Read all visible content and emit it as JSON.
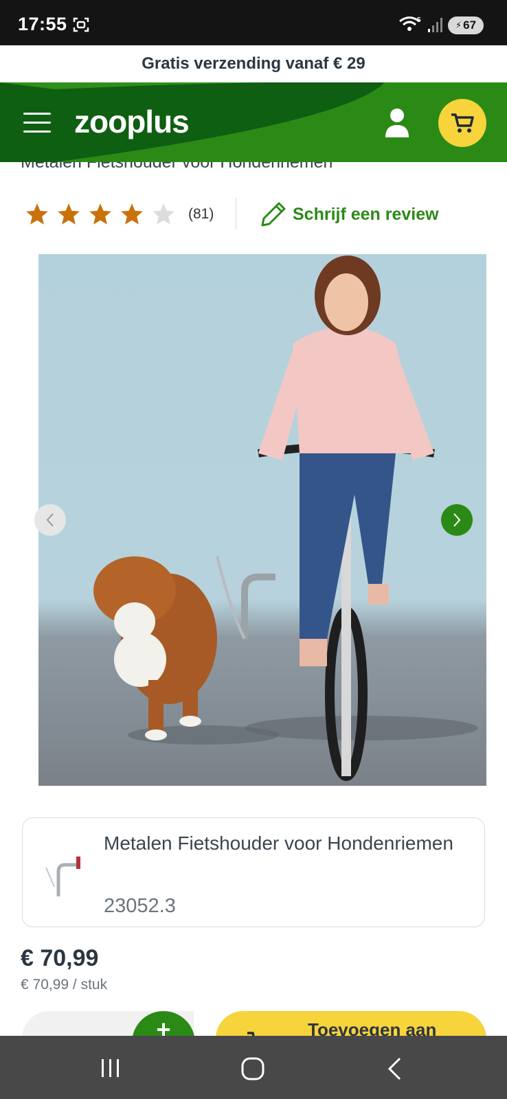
{
  "status_bar": {
    "time": "17:55",
    "battery": "67",
    "network": "5"
  },
  "promo": {
    "text": "Gratis verzending vanaf € 29"
  },
  "header": {
    "logo": "zooplus"
  },
  "product": {
    "title": "Metalen Fietshouder voor Hondenriemen",
    "rating": 4,
    "rating_max": 5,
    "review_count": "(81)",
    "write_review_label": "Schrijf een review",
    "variant": {
      "name": "Metalen Fietshouder voor Hondenriemen",
      "code": "23052.3"
    },
    "price": "€ 70,99",
    "unit_price": "€ 70,99 / stuk",
    "add_to_cart_label": "Toevoegen aan",
    "qty_plus": "+"
  },
  "colors": {
    "brand_green": "#2b8a16",
    "header_dark": "#0e5f12",
    "accent_yellow": "#f7d33c",
    "star": "#c9720c"
  }
}
